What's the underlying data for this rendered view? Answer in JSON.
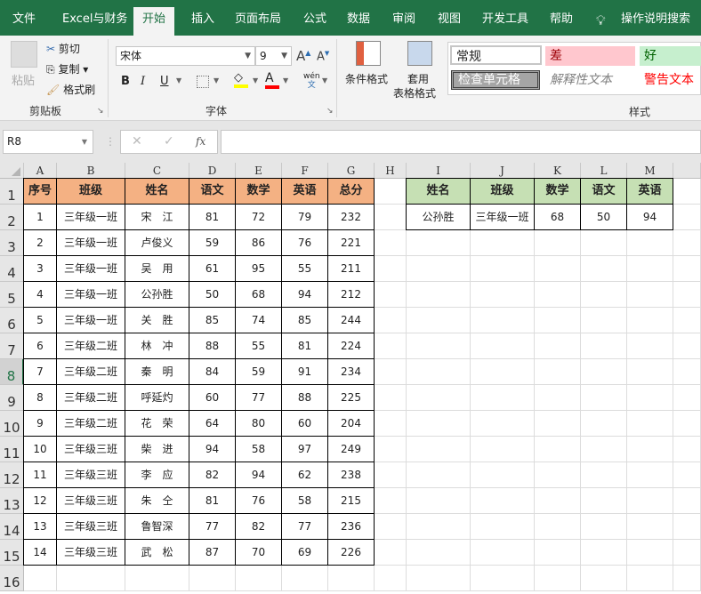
{
  "colors": {
    "brand": "#217346",
    "main_header_fill": "#f4b183",
    "lookup_header_fill": "#c6e0b4"
  },
  "tabs": [
    "文件",
    "Excel与财务",
    "开始",
    "插入",
    "页面布局",
    "公式",
    "数据",
    "审阅",
    "视图",
    "开发工具",
    "帮助"
  ],
  "active_tab": "开始",
  "search": {
    "icon": "lightbulb-icon",
    "label": "操作说明搜索"
  },
  "clipboard": {
    "paste": "粘贴",
    "cut": "剪切",
    "copy": "复制",
    "format_painter": "格式刷",
    "group": "剪贴板"
  },
  "font": {
    "name": "宋体",
    "size": "9",
    "bold": "B",
    "italic": "I",
    "underline": "U",
    "phonetic": "wén",
    "phonetic_char": "文",
    "group": "字体"
  },
  "styles": {
    "conditional": "条件格式",
    "table_format_1": "套用",
    "table_format_2": "表格格式",
    "normal": "常规",
    "bad": "差",
    "good": "好",
    "check": "检查单元格",
    "explanatory": "解释性文本",
    "warning": "警告文本",
    "group": "样式"
  },
  "formula_bar": {
    "name_box": "R8",
    "cancel": "✕",
    "enter": "✓",
    "fx": "fx",
    "value": ""
  },
  "columns": [
    "A",
    "B",
    "C",
    "D",
    "E",
    "F",
    "G",
    "H",
    "I",
    "J",
    "K",
    "L",
    "M"
  ],
  "rows": [
    "1",
    "2",
    "3",
    "4",
    "5",
    "6",
    "7",
    "8",
    "9",
    "10",
    "11",
    "12",
    "13",
    "14",
    "15",
    "16"
  ],
  "selected_row": "8",
  "main_table": {
    "headers": [
      "序号",
      "班级",
      "姓名",
      "语文",
      "数学",
      "英语",
      "总分"
    ],
    "rows": [
      [
        "1",
        "三年级一班",
        "宋　江",
        "81",
        "72",
        "79",
        "232"
      ],
      [
        "2",
        "三年级一班",
        "卢俊义",
        "59",
        "86",
        "76",
        "221"
      ],
      [
        "3",
        "三年级一班",
        "吴　用",
        "61",
        "95",
        "55",
        "211"
      ],
      [
        "4",
        "三年级一班",
        "公孙胜",
        "50",
        "68",
        "94",
        "212"
      ],
      [
        "5",
        "三年级一班",
        "关　胜",
        "85",
        "74",
        "85",
        "244"
      ],
      [
        "6",
        "三年级二班",
        "林　冲",
        "88",
        "55",
        "81",
        "224"
      ],
      [
        "7",
        "三年级二班",
        "秦　明",
        "84",
        "59",
        "91",
        "234"
      ],
      [
        "8",
        "三年级二班",
        "呼延灼",
        "60",
        "77",
        "88",
        "225"
      ],
      [
        "9",
        "三年级二班",
        "花　荣",
        "64",
        "80",
        "60",
        "204"
      ],
      [
        "10",
        "三年级三班",
        "柴　进",
        "94",
        "58",
        "97",
        "249"
      ],
      [
        "11",
        "三年级三班",
        "李　应",
        "82",
        "94",
        "62",
        "238"
      ],
      [
        "12",
        "三年级三班",
        "朱　仝",
        "81",
        "76",
        "58",
        "215"
      ],
      [
        "13",
        "三年级三班",
        "鲁智深",
        "77",
        "82",
        "77",
        "236"
      ],
      [
        "14",
        "三年级三班",
        "武　松",
        "87",
        "70",
        "69",
        "226"
      ]
    ]
  },
  "lookup_table": {
    "headers": [
      "姓名",
      "班级",
      "数学",
      "语文",
      "英语"
    ],
    "rows": [
      [
        "公孙胜",
        "三年级一班",
        "68",
        "50",
        "94"
      ]
    ]
  }
}
